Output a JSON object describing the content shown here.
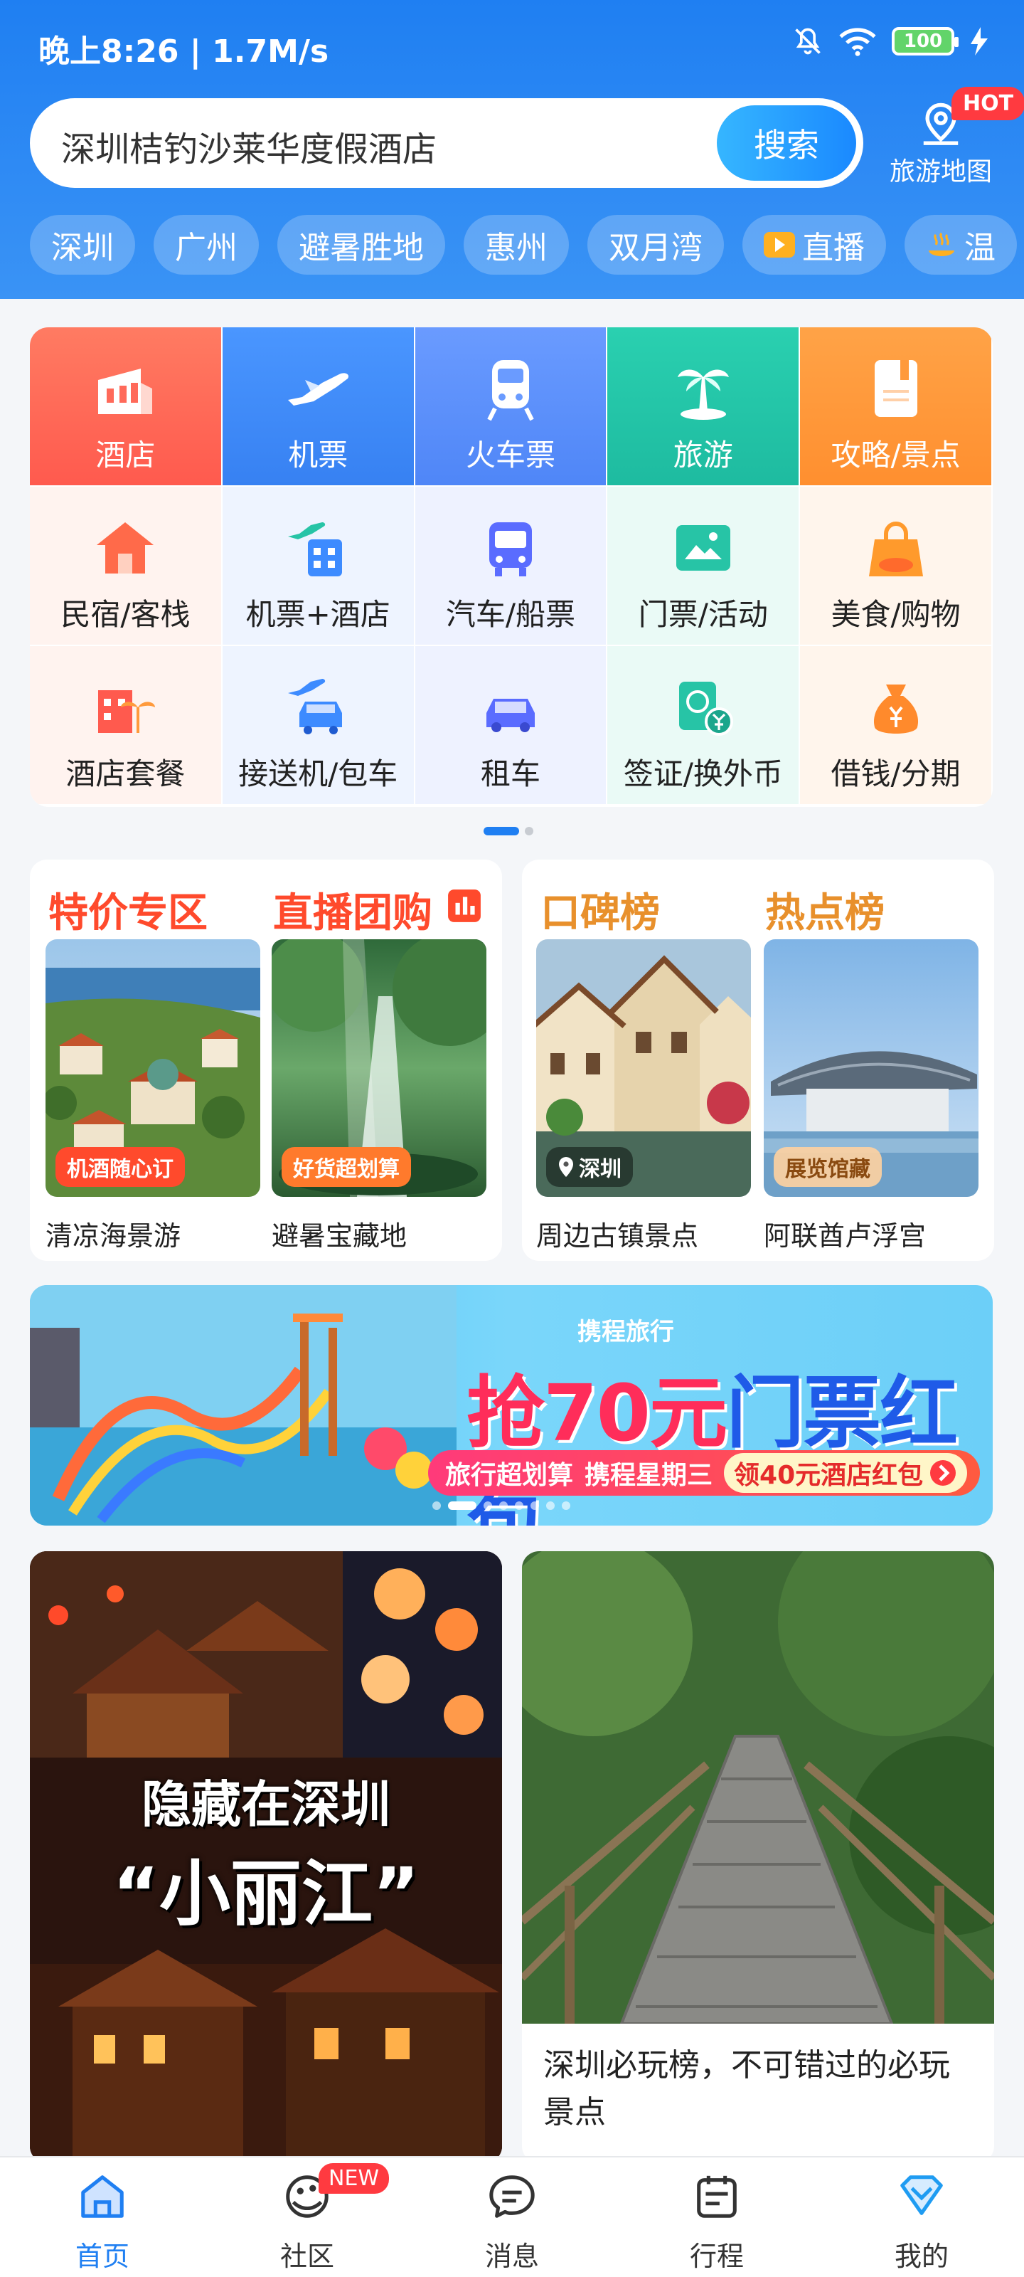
{
  "status_bar": {
    "time": "晚上8:26 | 1.7M/s",
    "battery": "100"
  },
  "search": {
    "value": "深圳桔钓沙莱华度假酒店",
    "button_label": "搜索"
  },
  "travel_map": {
    "label": "旅游地图",
    "badge": "HOT"
  },
  "chips": [
    "深圳",
    "广州",
    "避暑胜地",
    "惠州",
    "双月湾",
    "直播",
    "温"
  ],
  "grid": {
    "row1": [
      {
        "label": "酒店",
        "icon": "hotel-icon",
        "color": "#ff6a5a"
      },
      {
        "label": "机票",
        "icon": "airplane-icon",
        "color": "#3d8bff"
      },
      {
        "label": "火车票",
        "icon": "train-icon",
        "color": "#5a8cff"
      },
      {
        "label": "旅游",
        "icon": "palm-tree-icon",
        "color": "#27c4a6"
      },
      {
        "label": "攻略/景点",
        "icon": "guide-book-icon",
        "color": "#ff9a3c"
      }
    ],
    "row2": [
      {
        "label": "民宿/客栈",
        "icon": "house-icon"
      },
      {
        "label": "机票+酒店",
        "icon": "flight-hotel-icon"
      },
      {
        "label": "汽车/船票",
        "icon": "bus-icon"
      },
      {
        "label": "门票/活动",
        "icon": "ticket-icon"
      },
      {
        "label": "美食/购物",
        "icon": "shopping-bag-icon"
      }
    ],
    "row3": [
      {
        "label": "酒店套餐",
        "icon": "hotel-package-icon"
      },
      {
        "label": "接送机/包车",
        "icon": "airport-transfer-icon"
      },
      {
        "label": "租车",
        "icon": "car-icon"
      },
      {
        "label": "签证/换外币",
        "icon": "visa-currency-icon"
      },
      {
        "label": "借钱/分期",
        "icon": "money-bag-icon"
      }
    ]
  },
  "promo_left": {
    "title1": "特价专区",
    "title2": "直播团购",
    "item1": {
      "tag": "机酒随心订",
      "caption": "清凉海景游"
    },
    "item2": {
      "tag": "好货超划算",
      "caption": "避暑宝藏地"
    }
  },
  "promo_right": {
    "title1": "口碑榜",
    "title2": "热点榜",
    "item1": {
      "tag": "深圳",
      "caption": "周边古镇景点"
    },
    "item2": {
      "tag": "展览馆藏",
      "caption": "阿联酋卢浮宫"
    }
  },
  "banner": {
    "brand": "携程旅行",
    "title_a": "抢70元",
    "title_b": "门票红包",
    "strip1": "旅行超划算",
    "strip2": "携程星期三",
    "cta": "领40元酒店红包"
  },
  "feed": {
    "left_line1": "隐藏在深圳",
    "left_line2": "“小丽江”",
    "right_title": "深圳必玩榜，不可错过的必玩景点"
  },
  "bottom_nav": [
    {
      "label": "首页",
      "icon": "home-icon",
      "active": true
    },
    {
      "label": "社区",
      "icon": "community-icon",
      "badge": "NEW"
    },
    {
      "label": "消息",
      "icon": "message-icon"
    },
    {
      "label": "行程",
      "icon": "itinerary-icon"
    },
    {
      "label": "我的",
      "icon": "profile-icon"
    }
  ]
}
